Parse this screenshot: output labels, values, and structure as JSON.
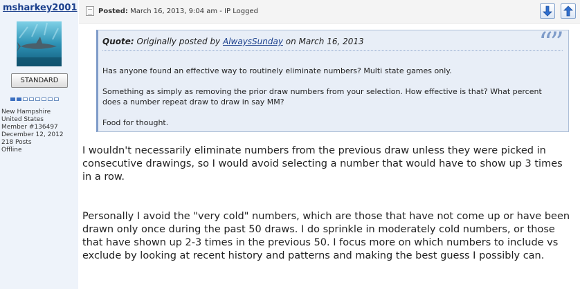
{
  "author": {
    "username": "msharkey2001",
    "rank": "STANDARD",
    "rank_level": 2,
    "rank_total": 8,
    "location_state": "New Hampshire",
    "location_country": "United States",
    "member_number": "Member #136497",
    "join_date": "December 12, 2012",
    "posts": "218 Posts",
    "status": "Offline"
  },
  "header": {
    "posted_label": "Posted:",
    "posted_text": "March 16, 2013, 9:04 am - IP Logged",
    "down_icon": "arrow-down-icon",
    "up_icon": "arrow-up-icon"
  },
  "quote": {
    "label": "Quote:",
    "prefix": "Originally posted by",
    "author": "AlwaysSunday",
    "on_text": "on March 16, 2013",
    "mark": "“”",
    "paragraphs": [
      "Has anyone found an effective way to routinely eliminate numbers? Multi state games only.",
      "Something as simply as removing the prior draw numbers from your selection. How effective is that? What percent does a number repeat draw to draw in say MM?",
      "Food for thought."
    ]
  },
  "body": {
    "paragraphs": [
      "I wouldn't necessarily eliminate numbers from the previous draw unless they were picked in consecutive drawings, so I would avoid selecting a number that would have to show up 3 times in a row.",
      "Personally I avoid the \"very cold\" numbers, which are those that have not come up or have been drawn only once during the past 50 draws. I do sprinkle in moderately cold numbers, or those that have shown up 2-3 times in the previous 50. I focus more on which numbers to include vs exclude by looking at recent history and patterns and making the best guess I possibly can."
    ]
  },
  "colors": {
    "link": "#1a3f8c",
    "quote_bg": "#e8eef7",
    "accent": "#7f9cc9"
  }
}
